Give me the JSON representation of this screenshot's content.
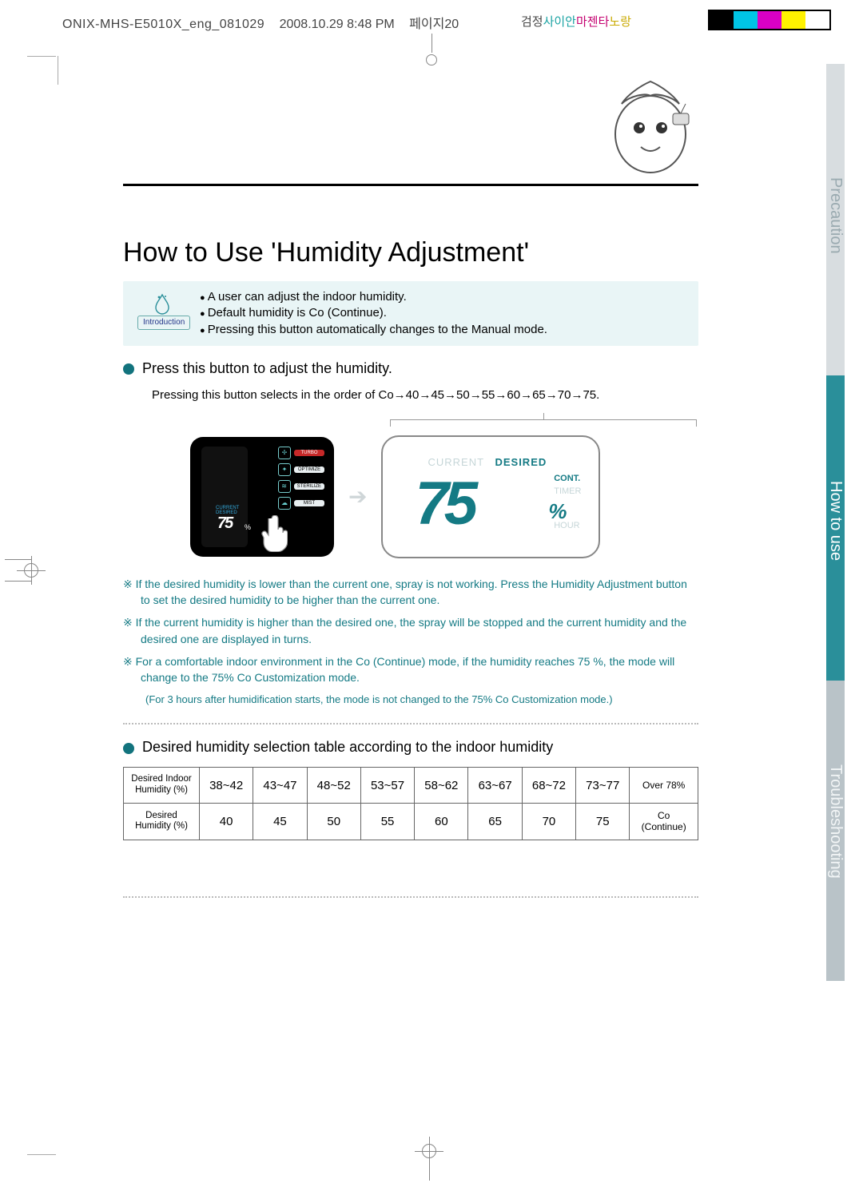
{
  "header": {
    "filename": "ONIX-MHS-E5010X_eng_081029",
    "datetime": "2008.10.29 8:48 PM",
    "pageword": "페이지20",
    "korean_label": {
      "pre": "검정",
      "cyan": "사이안",
      "mag": "마젠타",
      "yel": "노랑"
    }
  },
  "side_tabs": {
    "precaution": "Precaution",
    "howto": "How to use",
    "trouble": "Troubleshooting"
  },
  "title": "How to Use 'Humidity Adjustment'",
  "introbox": {
    "label": "Introduction",
    "items": [
      "A user can adjust the indoor humidity.",
      "Default humidity is Co (Continue).",
      "Pressing this button automatically changes to the Manual mode."
    ]
  },
  "bullet1": "Press this button to adjust the humidity.",
  "sequence": "Pressing this button selects in the order of Co→40→45→50→55→60→65→70→75.",
  "panel_left": {
    "buttons": [
      "TURBO",
      "OPTIMIZE",
      "STERILIZE",
      "MIST"
    ],
    "current_label": "CURRENT",
    "desired_label": "DESIRED",
    "digits": "75",
    "pct": "%"
  },
  "panel_right": {
    "current": "CURRENT",
    "desired": "DESIRED",
    "digits": "75",
    "cont": "CONT.",
    "timer": "TIMER",
    "hour": "HOUR",
    "pct": "%"
  },
  "notes": [
    "If the desired humidity is lower than the current one, spray is not working. Press the Humidity Adjustment button to set the desired humidity to be higher than the current one.",
    "If the current humidity is higher than the desired one, the spray will be stopped and the current humidity and the desired one are displayed in turns.",
    "For a comfortable indoor environment in the Co (Continue) mode, if the humidity reaches 75 %, the mode will change to the 75% Co Customization mode."
  ],
  "subnote": "(For 3 hours after humidification starts, the mode is not changed to the 75% Co Customization mode.)",
  "bullet2": "Desired humidity selection table according to the indoor humidity",
  "table": {
    "row1_label": "Desired Indoor\nHumidity (%)",
    "row2_label": "Desired\nHumidity (%)",
    "ranges": [
      "38~42",
      "43~47",
      "48~52",
      "53~57",
      "58~62",
      "63~67",
      "68~72",
      "73~77",
      "Over 78%"
    ],
    "values": [
      "40",
      "45",
      "50",
      "55",
      "60",
      "65",
      "70",
      "75",
      "Co\n(Continue)"
    ]
  },
  "chart_data": {
    "type": "table",
    "title": "Desired humidity selection table according to the indoor humidity",
    "columns": [
      "Desired Indoor Humidity (%)",
      "Desired Humidity (%)"
    ],
    "rows": [
      [
        "38~42",
        "40"
      ],
      [
        "43~47",
        "45"
      ],
      [
        "48~52",
        "50"
      ],
      [
        "53~57",
        "55"
      ],
      [
        "58~62",
        "60"
      ],
      [
        "63~67",
        "65"
      ],
      [
        "68~72",
        "70"
      ],
      [
        "73~77",
        "75"
      ],
      [
        "Over 78%",
        "Co (Continue)"
      ]
    ]
  }
}
